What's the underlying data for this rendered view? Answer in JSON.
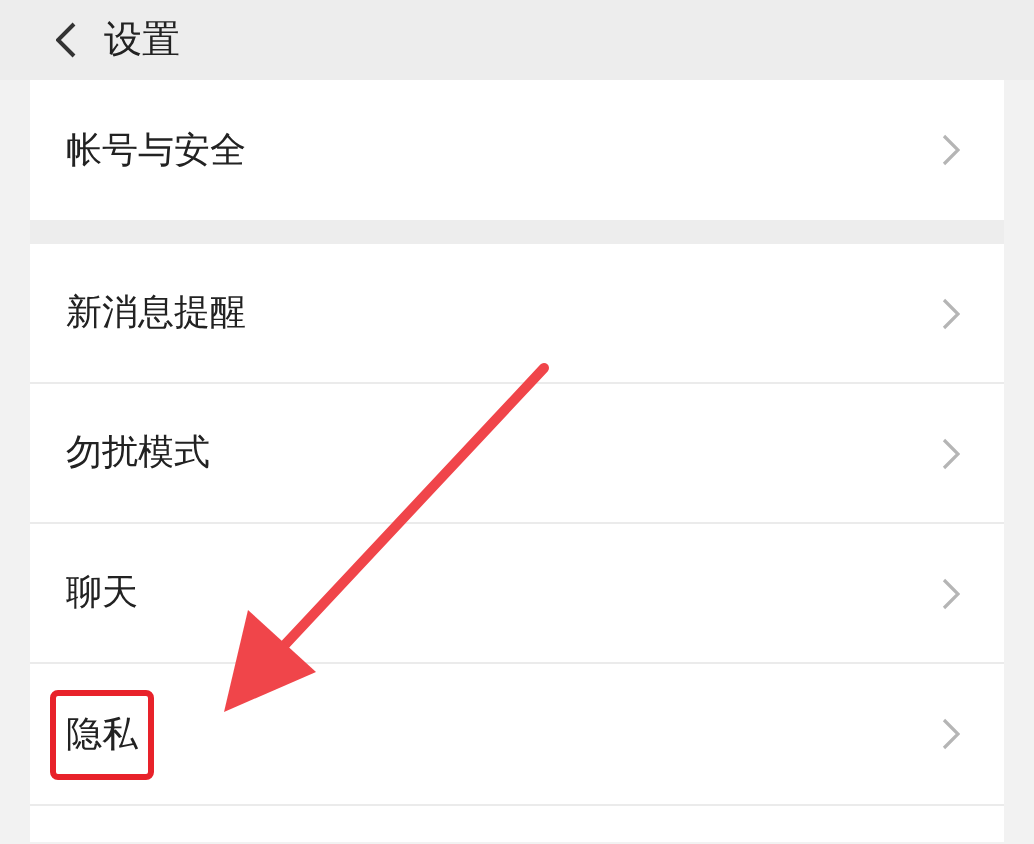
{
  "header": {
    "title": "设置"
  },
  "groups": [
    {
      "items": [
        {
          "label": "帐号与安全",
          "annotated": false
        }
      ]
    },
    {
      "items": [
        {
          "label": "新消息提醒",
          "annotated": false
        },
        {
          "label": "勿扰模式",
          "annotated": false
        },
        {
          "label": "聊天",
          "annotated": false
        },
        {
          "label": "隐私",
          "annotated": true
        }
      ]
    }
  ]
}
